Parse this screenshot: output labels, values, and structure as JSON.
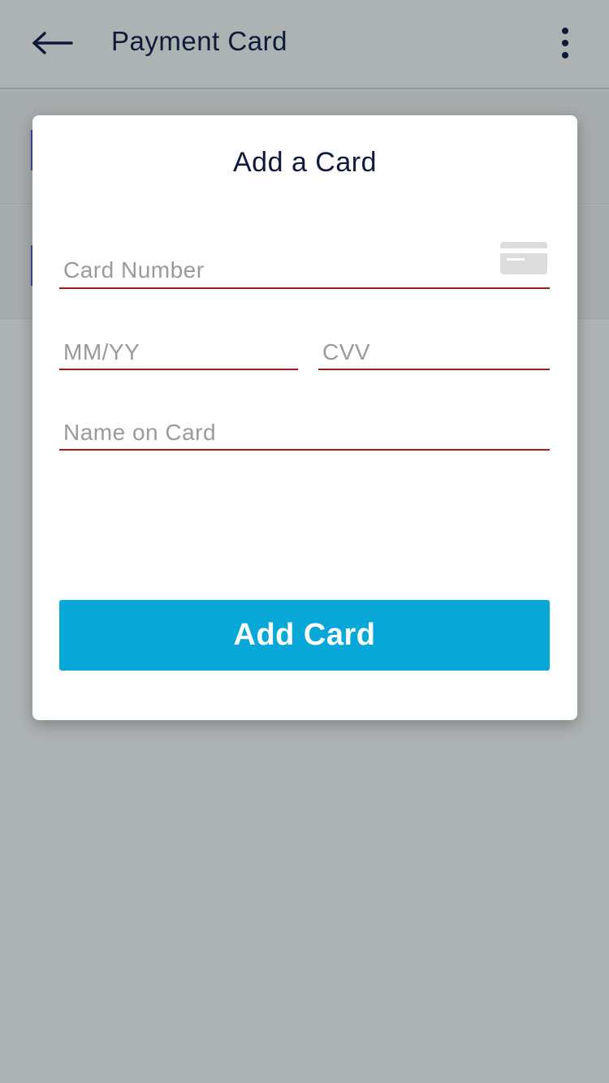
{
  "app_bar": {
    "title": "Payment Card",
    "back_icon": "arrow-left-icon",
    "more_icon": "more-vertical-icon"
  },
  "dialog": {
    "title": "Add a Card",
    "fields": {
      "card_number": {
        "placeholder": "Card Number",
        "value": ""
      },
      "expiry": {
        "placeholder": "MM/YY",
        "value": ""
      },
      "cvv": {
        "placeholder": "CVV",
        "value": ""
      },
      "name": {
        "placeholder": "Name on Card",
        "value": ""
      }
    },
    "card_icon": "credit-card-icon",
    "submit_label": "Add Card"
  },
  "colors": {
    "accent": "#07a8d8",
    "field_underline": "#a31c1c",
    "title_text": "#0f1a3a",
    "scrim": "#adb2b3"
  }
}
